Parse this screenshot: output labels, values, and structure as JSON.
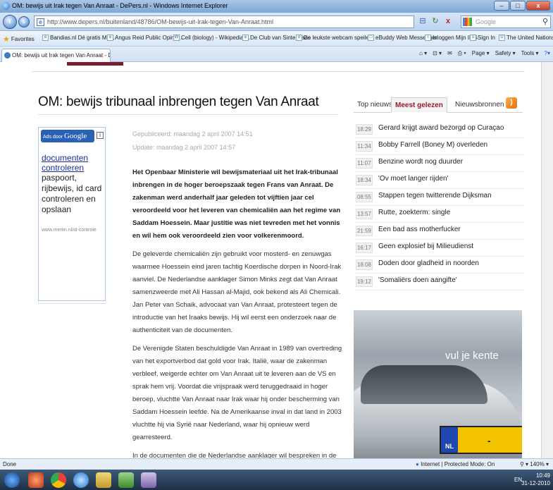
{
  "browser": {
    "window_title": "OM: bewijs uit Irak tegen Van Anraat - DePers.nl - Windows Internet Explorer",
    "address": "http://www.depers.nl/buitenland/48786/OM-bewijs-uit-Irak-tegen-Van-Anraat.html",
    "search_placeholder": "Google",
    "tab_label": "OM: bewijs uit Irak tegen Van Anraat - DePers.nl",
    "favorites": [
      "Favorites",
      "Bandias.nl Dé gratis MM...",
      "Angus Reid Public Opinio...",
      "Cell (biology) - Wikipedia,...",
      "De Club van Sinterklaas",
      "De leukste webcam speile...",
      "eBuddy Web Messenger",
      "Inloggen Mijn ING",
      "Sign In",
      "The United Nations at a Gl..."
    ],
    "commands": [
      "Page ▾",
      "Safety ▾",
      "Tools ▾"
    ],
    "status_left": "Done",
    "status_zone": "Internet | Protected Mode: On",
    "zoom": "140%"
  },
  "article": {
    "headline": "OM: bewijs tribunaal inbrengen tegen Van Anraat",
    "published": "Gepubliceerd: maandag 2 april 2007 14:51",
    "updated": "Update: maandag 2 april 2007 14:57",
    "lead": "Het Openbaar Ministerie wil bewijsmateriaal uit het Irak-tribunaal inbrengen in de hoger beroepszaak tegen Frans van Anraat. De zakenman werd anderhalf jaar geleden tot vijftien jaar cel veroordeeld voor het leveren van chemicaliën aan het regime van Saddam Hoessein. Maar justitie was niet tevreden met het vonnis en wil hem ook veroordeeld zien voor volkerenmoord.",
    "p1": "De geleverde chemicaliën zijn gebruikt voor mosterd- en zenuwgas waarmee Hoessein eind jaren tachtig Koerdische dorpen in Noord-Irak aanviel. De Nederlandse aanklager Simon Minks zegt dat Van Anraat samenzweerde met Ali Hassan al-Majid, ook bekend als Ali Chemicali. Jan Peter van Schaik, advocaat van Van Anraat, protesteert tegen de introductie van het Iraaks bewijs. Hij wil eerst een onderzoek naar de authenticiteit van de documenten.",
    "p2": "De Verenigde Staten beschuldigde Van Anraat in 1989 van overtreding van het exportverbod dat gold voor Irak. Italië, waar de zakenman verbleef, weigerde echter om Van Anraat uit te leveren aan de VS en sprak hem vrij. Voordat die vrijspraak werd teruggedraaid in hoger beroep, vluchtte Van Anraat naar Irak waar hij onder bescherming van Saddam Hoessein leefde. Na de Amerikaanse inval in dat land in 2003 vluchtte hij via Syrië naar Nederland, waar hij opnieuw werd gearresteerd.",
    "p3": "In de documenten die de Nederlandse aanklager wil bespreken in de hoger beroepszaak staat dat de zakenman een Iraaks paspoort kreeg. Het paspoort zou hem zijn toegekomen als dank voor zijn 'waardevolle diensten', waaronder 'het leveren van"
  },
  "ad": {
    "header_small": "Ads door",
    "header_brand": "Google",
    "link": "documenten controleren",
    "text": "paspoort, rijbewijs, id card controleren en opslaan",
    "url": "www.merlin.nl/id-controle"
  },
  "sidebar": {
    "tabs": [
      "Top nieuws",
      "Meest gelezen",
      "Nieuwsbronnen"
    ],
    "news": [
      {
        "time": "18:29",
        "title": "Gerard krijgt award bezorgd op Curaçao"
      },
      {
        "time": "11:34",
        "title": "Bobby Farrell (Boney M) overleden"
      },
      {
        "time": "11:07",
        "title": "Benzine wordt nog duurder"
      },
      {
        "time": "18:34",
        "title": "'Ov moet langer rijden'"
      },
      {
        "time": "08:55",
        "title": "Stappen tegen twitterende Dijksman"
      },
      {
        "time": "13:57",
        "title": "Rutte, zoekterm: single"
      },
      {
        "time": "21:59",
        "title": "Een bad ass motherfucker"
      },
      {
        "time": "16:17",
        "title": "Geen explosief bij Milieudienst"
      },
      {
        "time": "18:08",
        "title": "Doden door gladheid in noorden"
      },
      {
        "time": "19:12",
        "title": "'Somaliërs doen aangifte'"
      }
    ]
  },
  "car_ad": {
    "caption": "vul je kente",
    "plate_country": "NL",
    "plate_text": "-"
  },
  "taskbar": {
    "lang": "EN",
    "time": "10:49",
    "date": "31-12-2010"
  }
}
